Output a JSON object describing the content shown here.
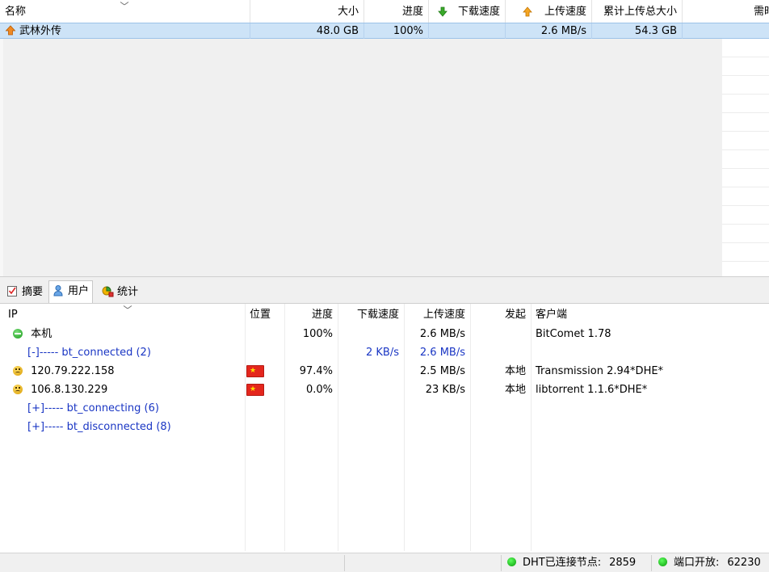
{
  "torrent_list": {
    "columns": [
      "名称",
      "大小",
      "进度",
      "下载速度",
      "上传速度",
      "累计上传总大小",
      "需时"
    ],
    "rows": [
      {
        "name": "武林外传",
        "size": "48.0 GB",
        "progress": "100%",
        "download_speed": "",
        "upload_speed": "2.6 MB/s",
        "total_uploaded": "54.3 GB",
        "eta": ""
      }
    ]
  },
  "tabs": [
    {
      "label": "摘要",
      "icon": "checklist-icon"
    },
    {
      "label": "用户",
      "icon": "user-icon",
      "active": true
    },
    {
      "label": "统计",
      "icon": "stats-icon"
    }
  ],
  "peers": {
    "columns": [
      "IP",
      "位置",
      "进度",
      "下载速度",
      "上传速度",
      "发起",
      "客户端"
    ],
    "rows": [
      {
        "ip": "本机",
        "location": "",
        "progress": "100%",
        "download_speed": "",
        "upload_speed": "2.6 MB/s",
        "initiated": "",
        "client": "BitComet 1.78",
        "icon": "green-face-icon"
      },
      {
        "ip": "[-]----- bt_connected (2)",
        "location": "",
        "progress": "",
        "download_speed": "2 KB/s",
        "upload_speed": "2.6 MB/s",
        "initiated": "",
        "client": "",
        "group": true
      },
      {
        "ip": "120.79.222.158",
        "location": "china-flag",
        "progress": "97.4%",
        "download_speed": "",
        "upload_speed": "2.5 MB/s",
        "initiated": "本地",
        "client": "Transmission 2.94*DHE*",
        "icon": "yellow-face-icon"
      },
      {
        "ip": "106.8.130.229",
        "location": "china-flag",
        "progress": "0.0%",
        "download_speed": "",
        "upload_speed": "23 KB/s",
        "initiated": "本地",
        "client": "libtorrent 1.1.6*DHE*",
        "icon": "yellow-face-icon"
      },
      {
        "ip": "[+]----- bt_connecting (6)",
        "group": true
      },
      {
        "ip": "[+]----- bt_disconnected (8)",
        "group": true
      }
    ]
  },
  "status_bar": {
    "dht_label": "DHT已连接节点:",
    "dht_value": "2859",
    "port_label": "端口开放:",
    "port_value": "62230"
  },
  "colors": {
    "selection": "#cde3f7",
    "group_text": "#1a36c4",
    "status_ok": "#0a9a0a"
  }
}
